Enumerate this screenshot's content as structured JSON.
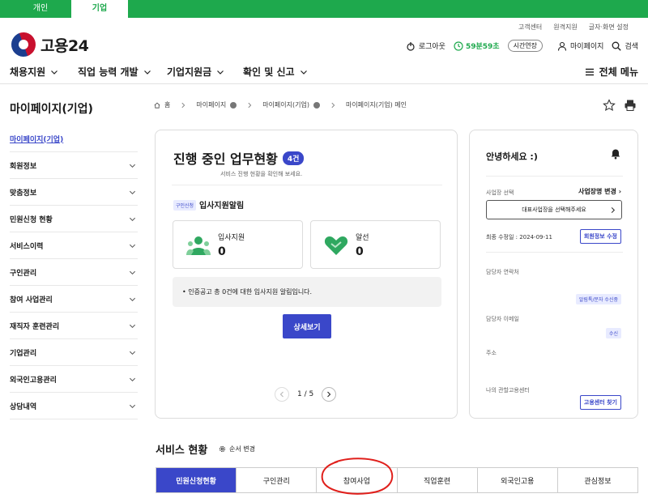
{
  "top_tabs": [
    "개인",
    "기업"
  ],
  "utility_links": [
    "고객센터",
    "원격지원",
    "글자·화면 설정"
  ],
  "logo": {
    "text": "고용24"
  },
  "header": {
    "logout": "로그아웃",
    "timer": "59분59초",
    "extend": "시간연장",
    "mypage": "마이페이지",
    "search": "검색"
  },
  "main_nav": [
    "채용지원",
    "직업 능력 개발",
    "기업지원금",
    "확인 및 신고"
  ],
  "all_menu": "전체 메뉴",
  "sidebar": {
    "title": "마이페이지(기업)",
    "items": [
      {
        "label": "마이페이지(기업)",
        "active": true,
        "chevron": false
      },
      {
        "label": "회원정보",
        "chevron": true
      },
      {
        "label": "맞춤정보",
        "chevron": true
      },
      {
        "label": "민원신청 현황",
        "chevron": true
      },
      {
        "label": "서비스이력",
        "chevron": true
      },
      {
        "label": "구인관리",
        "chevron": true
      },
      {
        "label": "참여 사업관리",
        "chevron": true
      },
      {
        "label": "재직자 훈련관리",
        "chevron": true
      },
      {
        "label": "기업관리",
        "chevron": true
      },
      {
        "label": "외국인고용관리",
        "chevron": true
      },
      {
        "label": "상담내역",
        "chevron": true
      }
    ]
  },
  "breadcrumb": [
    "홈",
    "마이페이지",
    "마이페이지(기업)",
    "마이페이지(기업) 메인"
  ],
  "work_status": {
    "title": "진행 중인 업무현황",
    "count": "4건",
    "subtitle": "서비스 진행 현황을 확인해 보세요.",
    "tag": "구인신청",
    "notice_title": "입사지원알림",
    "stats": [
      {
        "label": "입사지원",
        "value": "0",
        "icon": "people-icon"
      },
      {
        "label": "알선",
        "value": "0",
        "icon": "handshake-heart-icon"
      }
    ],
    "info": "• 인증공고 총 0건에 대한 입사지원 알림입니다.",
    "detail_button": "상세보기",
    "pager": "1 / 5"
  },
  "greeting": {
    "title": "안녕하세요 :)",
    "biz_label": "사업장 선택",
    "biz_change": "사업장명 변경",
    "biz_select_placeholder": "대표사업장을 선택해주세요",
    "modified": "최종 수정일 : 2024-09-11",
    "edit_member_button": "회원정보 수정",
    "contact_label": "담당자 연락처",
    "contact_pill": "알림톡/문자 수신중",
    "email_label": "담당자 이메일",
    "email_pill": "수신",
    "address_label": "주소",
    "center_label": "나의 관할고용센터",
    "center_button": "고용센터 찾기"
  },
  "service_status": {
    "title": "서비스 현황",
    "order_change": "순서 변경",
    "tabs": [
      "민원신청현황",
      "구인관리",
      "참여사업",
      "직업훈련",
      "외국인고용",
      "관심정보"
    ],
    "active_tab": 0
  },
  "colors": {
    "brand_green": "#1ea94d",
    "accent_blue": "#3a47c9",
    "annotation_red": "#e0201c"
  }
}
